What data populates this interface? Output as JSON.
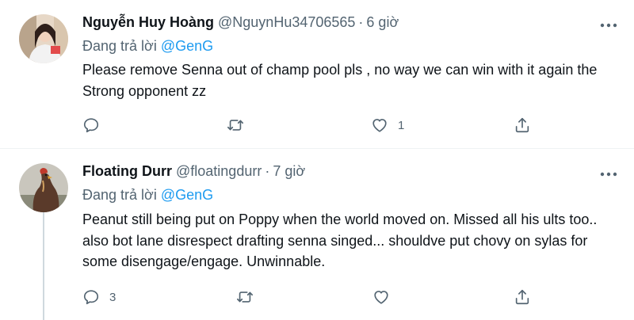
{
  "tweets": [
    {
      "name": "Nguyễn Huy Hoàng",
      "handle": "@NguynHu34706565",
      "separator": "·",
      "time": "6 giờ",
      "reply_prefix": "Đang trả lời",
      "reply_to": "@GenG",
      "text": "Please remove Senna out of champ pool pls , no way we can win with it again the Strong opponent zz",
      "reply_count": "",
      "retweet_count": "",
      "like_count": "1"
    },
    {
      "name": "Floating Durr",
      "handle": "@floatingdurr",
      "separator": "·",
      "time": "7 giờ",
      "reply_prefix": "Đang trả lời",
      "reply_to": "@GenG",
      "text": "Peanut still being put on Poppy when the world moved on. Missed all his ults too.. also bot lane disrespect drafting senna singed... shouldve put chovy on sylas for some disengage/engage. Unwinnable.",
      "reply_count": "3",
      "retweet_count": "",
      "like_count": ""
    }
  ],
  "icons": {
    "reply": "reply-icon",
    "retweet": "retweet-icon",
    "like": "heart-icon",
    "share": "share-icon",
    "more": "more-icon"
  },
  "colors": {
    "text": "#0f1419",
    "secondary": "#536471",
    "link": "#1d9bf0",
    "divider": "#eff3f4",
    "thread_line": "#cfd9de"
  }
}
